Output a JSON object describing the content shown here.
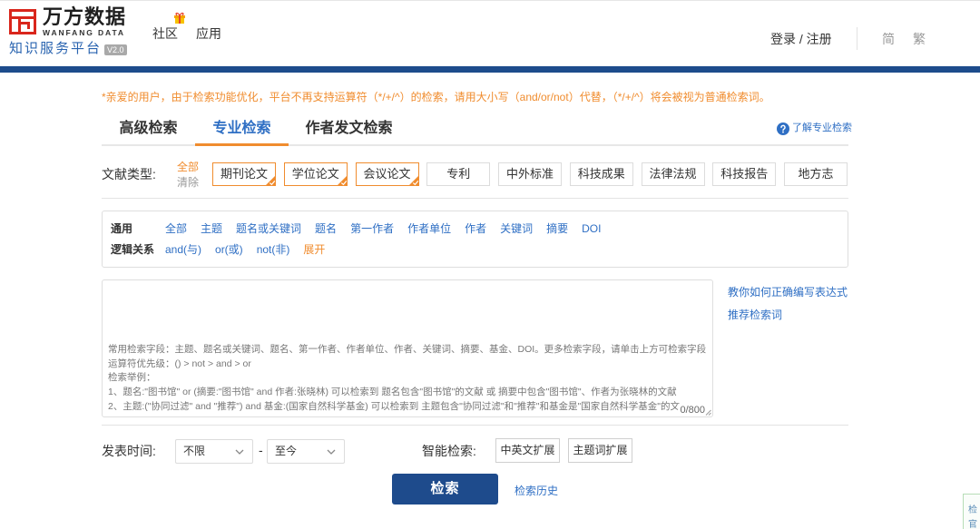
{
  "colors": {
    "brand_blue": "#1d4c8c",
    "accent_orange": "#f08c2e",
    "link_blue": "#2f6fc4",
    "logo_red": "#d9261c",
    "search_button": "#1e4b8c"
  },
  "header": {
    "logo": {
      "icon": "wanfang-logo-icon",
      "brand": "万方数据",
      "brand_en": "WANFANG DATA",
      "platform": "知识服务平台",
      "version": "V2.0"
    },
    "nav": [
      {
        "label": "社区",
        "badge_icon": "gift-icon"
      },
      {
        "label": "应用"
      }
    ],
    "auth": "登录 / 注册",
    "lang": [
      "简",
      "繁"
    ]
  },
  "notice": "*亲爱的用户，由于检索功能优化，平台不再支持运算符（*/+/^）的检索，请用大小写（and/or/not）代替，（*/+/^）将会被视为普通检索词。",
  "tabs": [
    {
      "label": "高级检索",
      "active": false
    },
    {
      "label": "专业检索",
      "active": true
    },
    {
      "label": "作者发文检索",
      "active": false
    }
  ],
  "help": {
    "icon": "question-circle-icon",
    "label": "了解专业检索"
  },
  "doc_types": {
    "label": "文献类型:",
    "select_all": "全部",
    "clear": "清除",
    "items": [
      {
        "label": "期刊论文",
        "selected": true
      },
      {
        "label": "学位论文",
        "selected": true
      },
      {
        "label": "会议论文",
        "selected": true
      },
      {
        "label": "专利",
        "selected": false
      },
      {
        "label": "中外标准",
        "selected": false
      },
      {
        "label": "科技成果",
        "selected": false
      },
      {
        "label": "法律法规",
        "selected": false
      },
      {
        "label": "科技报告",
        "selected": false
      },
      {
        "label": "地方志",
        "selected": false
      }
    ]
  },
  "fields": {
    "general_label": "通用",
    "general": [
      "全部",
      "主题",
      "题名或关键词",
      "题名",
      "第一作者",
      "作者单位",
      "作者",
      "关键词",
      "摘要",
      "DOI"
    ],
    "logic_label": "逻辑关系",
    "logic": [
      "and(与)",
      "or(或)",
      "not(非)"
    ],
    "expand": "展开"
  },
  "expression": {
    "value": "",
    "hint_lines": [
      "常用检索字段：主题、题名或关键词、题名、第一作者、作者单位、作者、关键词、摘要、基金、DOI。更多检索字段，请单击上方可检索字段",
      "运算符优先级：() > not > and > or",
      "检索举例：",
      "1、题名:\"图书馆\" or (摘要:\"图书馆\" and 作者:张晓林) 可以检索到 题名包含\"图书馆\"的文献 或 摘要中包含\"图书馆\"、作者为张晓林的文献",
      "2、主题:(\"协同过滤\" and \"推荐\") and 基金:(国家自然科学基金) 可以检索到 主题包含\"协同过滤\"和\"推荐\"和基金是\"国家自然科学基金\"的文"
    ],
    "counter": "0/800"
  },
  "side_links": [
    "教你如何正确编写表达式",
    "推荐检索词"
  ],
  "date": {
    "label": "发表时间:",
    "from": "不限",
    "separator": "-",
    "to": "至今"
  },
  "smart": {
    "label": "智能检索:",
    "options": [
      "中英文扩展",
      "主题词扩展"
    ]
  },
  "search_button": "检索",
  "history_link": "检索历史",
  "corner_widget": [
    "检",
    "官"
  ]
}
